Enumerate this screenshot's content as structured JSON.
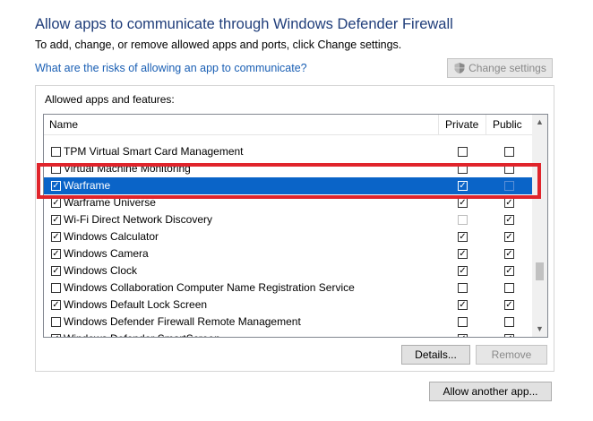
{
  "header": {
    "title": "Allow apps to communicate through Windows Defender Firewall",
    "subtitle": "To add, change, or remove allowed apps and ports, click Change settings.",
    "risk_link": "What are the risks of allowing an app to communicate?",
    "change_settings_label": "Change settings"
  },
  "group": {
    "label": "Allowed apps and features:",
    "columns": {
      "name": "Name",
      "private": "Private",
      "public": "Public"
    }
  },
  "apps": [
    {
      "name": "TPM Virtual Smart Card Management",
      "enabled": false,
      "private": false,
      "public": false,
      "selected": false
    },
    {
      "name": "Virtual Machine Monitoring",
      "enabled": false,
      "private": false,
      "public": false,
      "selected": false
    },
    {
      "name": "Warframe",
      "enabled": true,
      "private": true,
      "public": false,
      "selected": true
    },
    {
      "name": "Warframe Universe",
      "enabled": true,
      "private": true,
      "public": true,
      "selected": false
    },
    {
      "name": "Wi-Fi Direct Network Discovery",
      "enabled": true,
      "private": false,
      "public": true,
      "selected": false
    },
    {
      "name": "Windows Calculator",
      "enabled": true,
      "private": true,
      "public": true,
      "selected": false
    },
    {
      "name": "Windows Camera",
      "enabled": true,
      "private": true,
      "public": true,
      "selected": false
    },
    {
      "name": "Windows Clock",
      "enabled": true,
      "private": true,
      "public": true,
      "selected": false
    },
    {
      "name": "Windows Collaboration Computer Name Registration Service",
      "enabled": false,
      "private": false,
      "public": false,
      "selected": false
    },
    {
      "name": "Windows Default Lock Screen",
      "enabled": true,
      "private": true,
      "public": true,
      "selected": false
    },
    {
      "name": "Windows Defender Firewall Remote Management",
      "enabled": false,
      "private": false,
      "public": false,
      "selected": false
    },
    {
      "name": "Windows Defender SmartScreen",
      "enabled": true,
      "private": true,
      "public": true,
      "selected": false
    }
  ],
  "buttons": {
    "details": "Details...",
    "remove": "Remove",
    "allow_another": "Allow another app..."
  },
  "icons": {
    "shield": "uac-shield-icon",
    "check": "checkmark-icon",
    "scroll_up": "chevron-up-icon",
    "scroll_down": "chevron-down-icon"
  },
  "colors": {
    "selection": "#0a64c8",
    "highlight_box": "#e0242b",
    "link": "#1a5fb4"
  }
}
